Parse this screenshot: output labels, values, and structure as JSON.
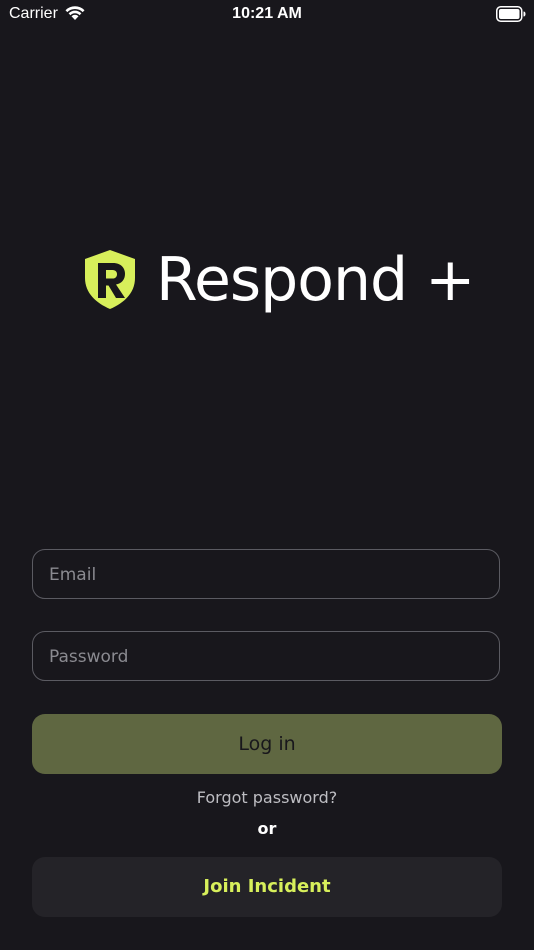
{
  "status_bar": {
    "carrier": "Carrier",
    "time": "10:21 AM",
    "wifi_icon": "wifi-icon",
    "battery_icon": "battery-full-icon"
  },
  "logo": {
    "text": "Respond +",
    "icon": "shield-r-icon"
  },
  "form": {
    "email_placeholder": "Email",
    "email_value": "",
    "password_placeholder": "Password",
    "password_value": ""
  },
  "actions": {
    "login_label": "Log in",
    "forgot_label": "Forgot password?",
    "or_label": "or",
    "join_label": "Join Incident"
  },
  "colors": {
    "background": "#18171c",
    "accent": "#d7ef5b",
    "login_button": "#5f6741",
    "join_button": "#242328",
    "field_border": "#5b5b62"
  }
}
